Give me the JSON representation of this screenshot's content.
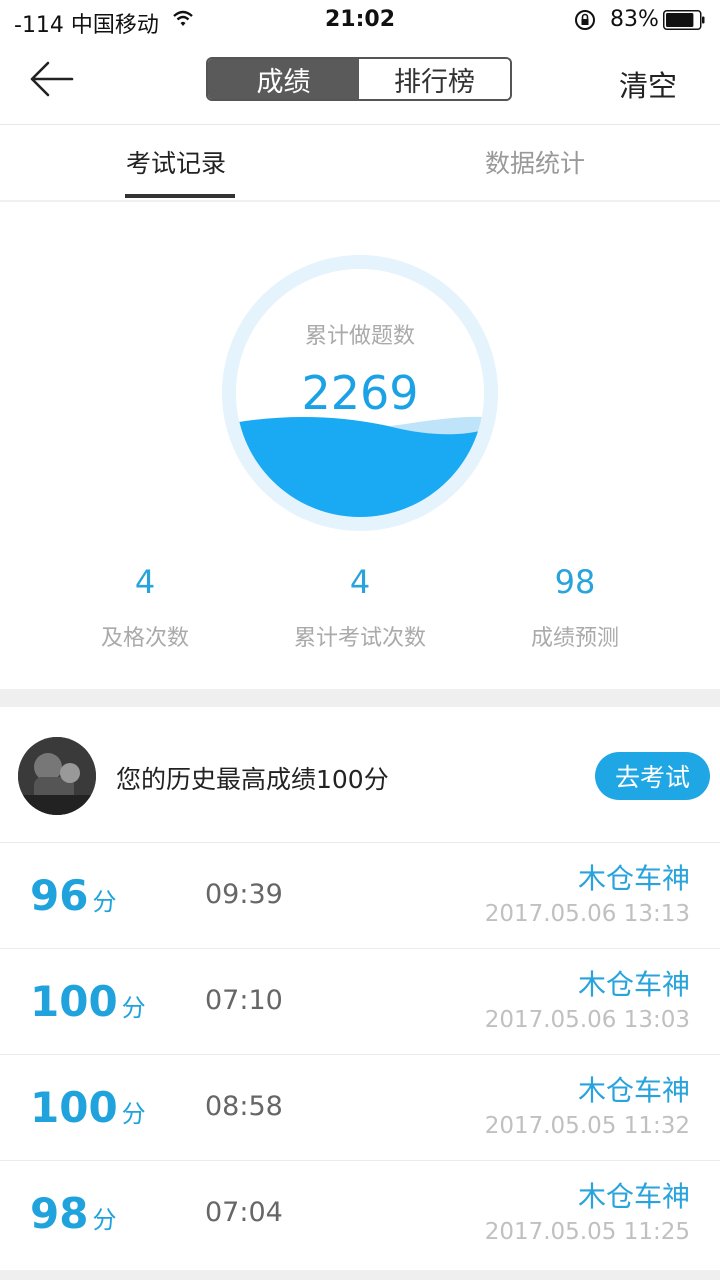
{
  "status_bar": {
    "carrier": "-114 中国移动",
    "time": "21:02",
    "battery_pct": "83%",
    "battery_level": 0.83
  },
  "nav": {
    "segments": [
      "成绩",
      "排行榜"
    ],
    "clear_label": "清空"
  },
  "tabs": [
    "考试记录",
    "数据统计"
  ],
  "gauge": {
    "label": "累计做题数",
    "value": "2269",
    "colors": {
      "ring": "#e4f3fc",
      "water": "#1aa9f3",
      "wave_back": "#bfe3f8"
    }
  },
  "stats": [
    {
      "value": "4",
      "label": "及格次数"
    },
    {
      "value": "4",
      "label": "累计考试次数"
    },
    {
      "value": "98",
      "label": "成绩预测"
    }
  ],
  "best": {
    "text": "您的历史最高成绩100分",
    "button": "去考试"
  },
  "records": [
    {
      "score": "96",
      "unit": "分",
      "duration": "09:39",
      "name": "木仓车神",
      "date": "2017.05.06 13:13"
    },
    {
      "score": "100",
      "unit": "分",
      "duration": "07:10",
      "name": "木仓车神",
      "date": "2017.05.06 13:03"
    },
    {
      "score": "100",
      "unit": "分",
      "duration": "08:58",
      "name": "木仓车神",
      "date": "2017.05.05 11:32"
    },
    {
      "score": "98",
      "unit": "分",
      "duration": "07:04",
      "name": "木仓车神",
      "date": "2017.05.05 11:25"
    }
  ],
  "accent_color": "#1ea7e4"
}
